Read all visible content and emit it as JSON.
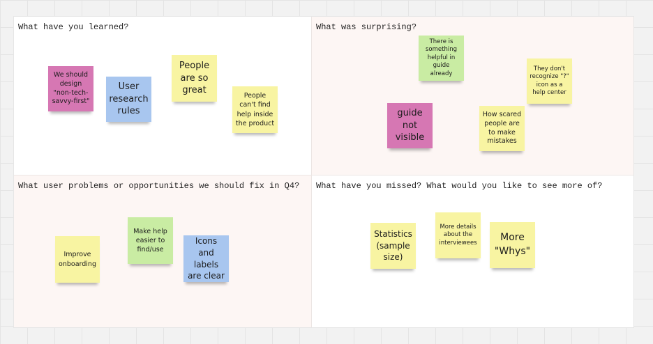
{
  "colors": {
    "canvas": "#f2f2f2",
    "quadrant_white": "#ffffff",
    "quadrant_tint": "#fdf6f4",
    "sticky_pink": "#d677b3",
    "sticky_blue": "#a8c6ef",
    "sticky_yellow": "#f8f4a2",
    "sticky_green": "#c9eca3"
  },
  "quadrants": {
    "learned": {
      "title": "What have you learned?",
      "notes": {
        "non_tech": "We should design \"non-tech-savvy-first\"",
        "research": "User research rules",
        "people_great": "People are so great",
        "cant_find_help": "People can't find help inside the product"
      }
    },
    "surprising": {
      "title": "What was surprising?",
      "notes": {
        "helpful_guide": "There is something helpful in guide already",
        "icon_help": "They don't recognize \"?\" icon as a help center",
        "guide_visible": "guide not visible",
        "scared": "How scared people are to make mistakes"
      }
    },
    "problems": {
      "title": "What user problems or opportunities we should fix in Q4?",
      "notes": {
        "onboarding": "Improve onboarding",
        "help_easier": "Make help easier to find/use",
        "icons_labels": "Icons and labels are clear"
      }
    },
    "missed": {
      "title": "What have you missed? What would you like to see more of?",
      "notes": {
        "statistics": "Statistics (sample size)",
        "more_details": "More details about the interviewees",
        "more_whys": "More \"Whys\""
      }
    }
  }
}
